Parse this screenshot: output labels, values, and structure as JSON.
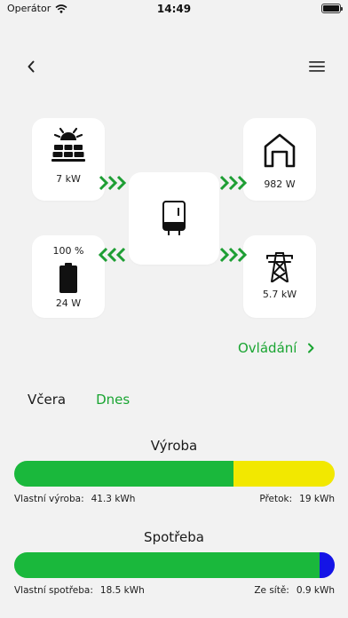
{
  "status_bar": {
    "carrier": "Operátor",
    "time": "14:49"
  },
  "flow": {
    "solar": {
      "value": "7 kW",
      "icon": "solar-panel-icon"
    },
    "home": {
      "value": "982 W",
      "icon": "house-icon"
    },
    "inverter": {
      "icon": "inverter-icon"
    },
    "battery": {
      "percent": "100 %",
      "value": "24 W",
      "icon": "battery-icon",
      "level": 1.0
    },
    "grid": {
      "value": "5.7 kW",
      "icon": "power-pylon-icon"
    },
    "arrows": {
      "solar_to_inverter": "right",
      "inverter_to_home": "right",
      "inverter_to_battery": "left",
      "inverter_to_grid": "right"
    }
  },
  "control_link": {
    "label": "Ovládání"
  },
  "tabs": [
    {
      "label": "Včera",
      "active": false
    },
    {
      "label": "Dnes",
      "active": true
    }
  ],
  "production": {
    "title": "Výroba",
    "self_label": "Vlastní výroba:",
    "self_value": "41.3 kWh",
    "export_label": "Přetok:",
    "export_value": "19 kWh",
    "self_kwh": 41.3,
    "export_kwh": 19
  },
  "consumption": {
    "title": "Spotřeba",
    "self_label": "Vlastní spotřeba:",
    "self_value": "18.5 kWh",
    "grid_label": "Ze sítě:",
    "grid_value": "0.9 kWh",
    "self_kwh": 18.5,
    "grid_kwh": 0.9
  },
  "colors": {
    "accent": "#1aa532",
    "bar_green": "#1ab83c",
    "bar_yellow": "#f2e800",
    "bar_blue": "#1414e6",
    "arrow_green": "#1e9e34"
  }
}
